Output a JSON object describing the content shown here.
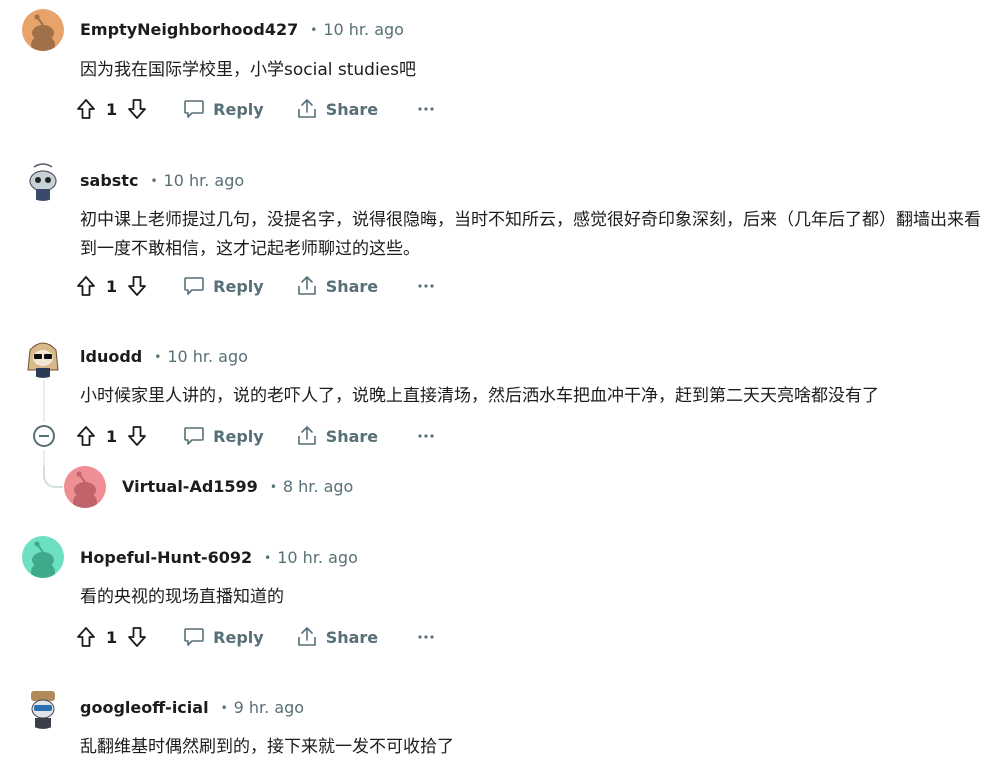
{
  "comments": [
    {
      "author": "EmptyNeighborhood427",
      "time": "10 hr. ago",
      "text": "因为我在国际学校里，小学social studies吧",
      "score": "1",
      "avatar_color": "#e8a36b"
    },
    {
      "author": "sabstc",
      "time": "10 hr. ago",
      "text": "初中课上老师提过几句，没提名字，说得很隐晦，当时不知所云，感觉很好奇印象深刻，后来（几年后了都）翻墙出来看到一度不敢相信，这才记起老师聊过的这些。",
      "score": "1",
      "avatar_color": "#dfe6ea"
    },
    {
      "author": "lduodd",
      "time": "10 hr. ago",
      "text": "小时候家里人讲的，说的老吓人了，说晚上直接清场，然后洒水车把血冲干净，赶到第二天天亮啥都没有了",
      "score": "1",
      "avatar_color": "#f1e7d4"
    },
    {
      "author": "Hopeful-Hunt-6092",
      "time": "10 hr. ago",
      "text": "看的央视的现场直播知道的",
      "score": "1",
      "avatar_color": "#6ee0c2"
    },
    {
      "author": "googleoff-icial",
      "time": "9 hr. ago",
      "text": "乱翻维基时偶然刷到的，接下来就一发不可收拾了",
      "avatar_color": "#dfe6ea"
    }
  ],
  "reply": {
    "author": "Virtual-Ad1599",
    "time": "8 hr. ago",
    "avatar_color": "#ef8f95"
  },
  "labels": {
    "reply": "Reply",
    "share": "Share",
    "dot": "•"
  },
  "icons": [
    "upvote-icon",
    "downvote-icon",
    "reply-icon",
    "share-icon",
    "more-icon",
    "collapse-icon"
  ]
}
